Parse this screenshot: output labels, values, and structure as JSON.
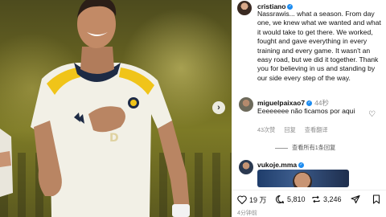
{
  "post": {
    "username": "cristiano",
    "caption": "Nassrawis... what a season. From day one, we knew what we wanted and what it would take to get there. We worked, fought and gave everything in every training and every game. It wasn't an easy road, but we did it together. Thank you for believing in us and standing by our side every step of the way.",
    "time_ago": "4分钟前"
  },
  "comments": [
    {
      "username": "miguelpaixao7",
      "time": "44秒",
      "text": "Eeeeeeee não ficamos por aqui",
      "likes": "43次赞",
      "reply_label": "回复",
      "translate_label": "查看翻译",
      "view_replies": "查看所有1条回复"
    },
    {
      "username": "vukoje.mma"
    }
  ],
  "actions": {
    "likes": "19 万",
    "comments": "5,810",
    "shares": "3,246"
  },
  "colors": {
    "verified": "#1d8cf0",
    "muted_text": "#8e8e8e",
    "jersey": "#f2f0e6",
    "jersey_trim": "#1d2a44",
    "shoulder_accent": "#f0c419"
  },
  "icons": [
    "chevron-right-icon",
    "heart-icon",
    "comment-icon",
    "repost-icon",
    "send-icon",
    "bookmark-icon",
    "verified-icon"
  ]
}
